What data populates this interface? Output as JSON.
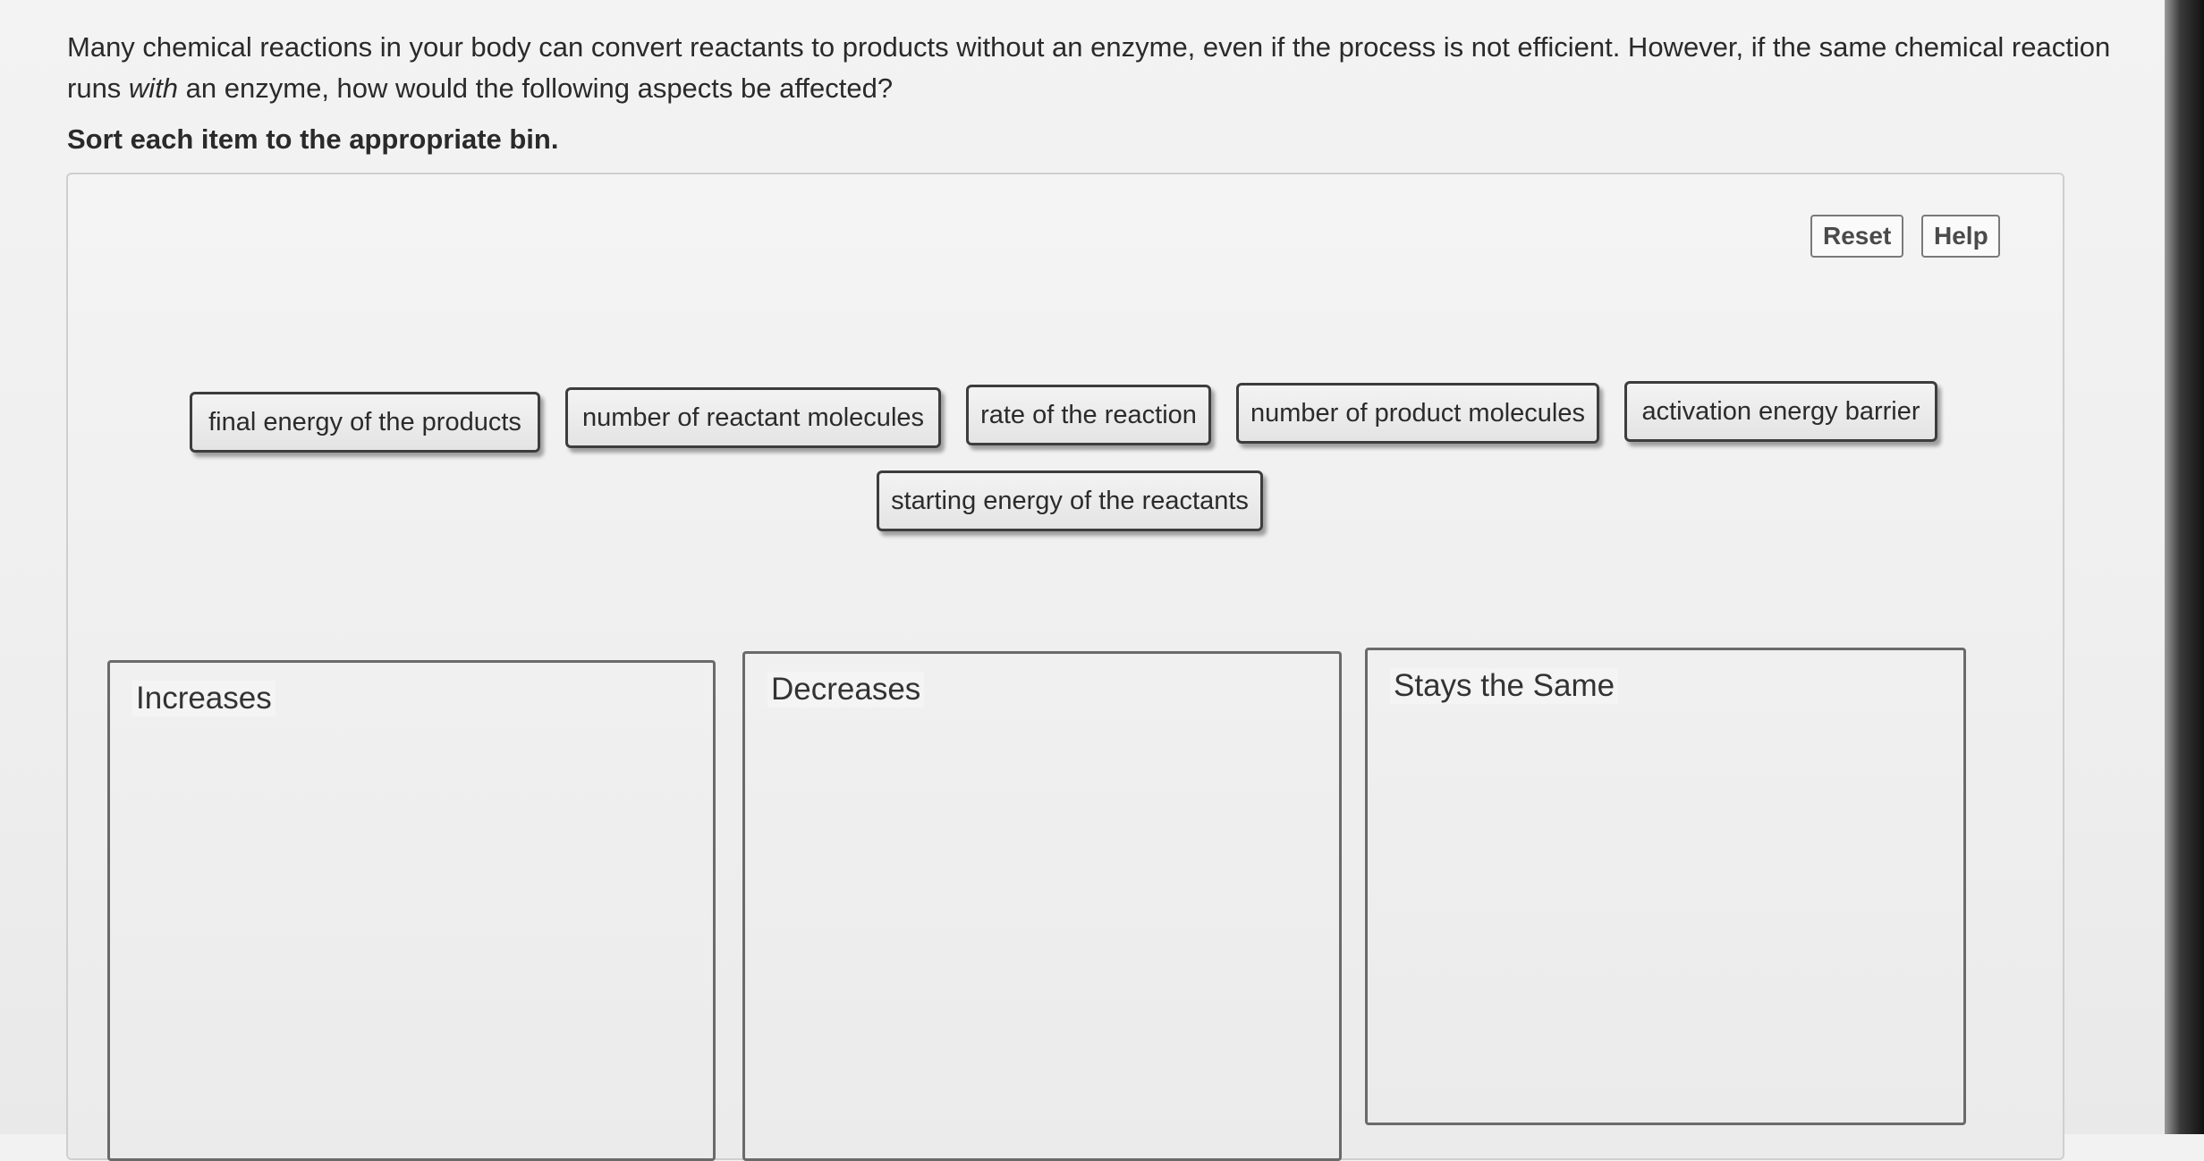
{
  "question": {
    "part1": "Many chemical reactions in your body can convert reactants to products without an enzyme, even if the process is not efficient. However, if the same chemical reaction runs ",
    "emphasis": "with",
    "part2": " an enzyme, how would the following aspects be affected?",
    "instruction": "Sort each item to the appropriate bin."
  },
  "toolbar": {
    "reset_label": "Reset",
    "help_label": "Help"
  },
  "items": [
    "final energy of the products",
    "number of reactant molecules",
    "rate of the reaction",
    "number of product molecules",
    "activation energy barrier",
    "starting energy of the reactants"
  ],
  "bins": [
    "Increases",
    "Decreases",
    "Stays the Same"
  ]
}
